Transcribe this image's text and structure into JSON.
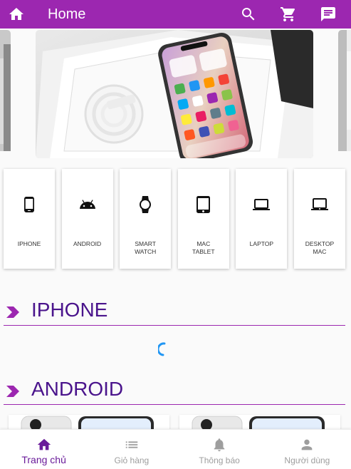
{
  "appbar": {
    "title": "Home",
    "color": "#9c27b0",
    "icons": [
      "home-icon",
      "search-icon",
      "cart-icon",
      "message-icon"
    ]
  },
  "categories": [
    {
      "label": "IPHONE",
      "icon": "phone-icon"
    },
    {
      "label": "ANDROID",
      "icon": "android-icon"
    },
    {
      "label": "SMART\nWATCH",
      "icon": "watch-icon"
    },
    {
      "label": "MAC\nTABLET",
      "icon": "tablet-icon"
    },
    {
      "label": "LAPTOP",
      "icon": "laptop-icon"
    },
    {
      "label": "DESKTOP\nMAC",
      "icon": "desktop-icon"
    }
  ],
  "sections": {
    "iphone": "IPHONE",
    "android": "ANDROID"
  },
  "bottom_nav": [
    {
      "label": "Trang chủ",
      "icon": "home-icon",
      "active": true
    },
    {
      "label": "Giỏ hàng",
      "icon": "list-icon",
      "active": false
    },
    {
      "label": "Thông báo",
      "icon": "bell-icon",
      "active": false
    },
    {
      "label": "Người dùng",
      "icon": "person-icon",
      "active": false
    }
  ],
  "colors": {
    "primary": "#9c27b0",
    "section_title": "#4a148c",
    "active_nav": "#6a1b9a",
    "spinner": "#2196f3"
  }
}
